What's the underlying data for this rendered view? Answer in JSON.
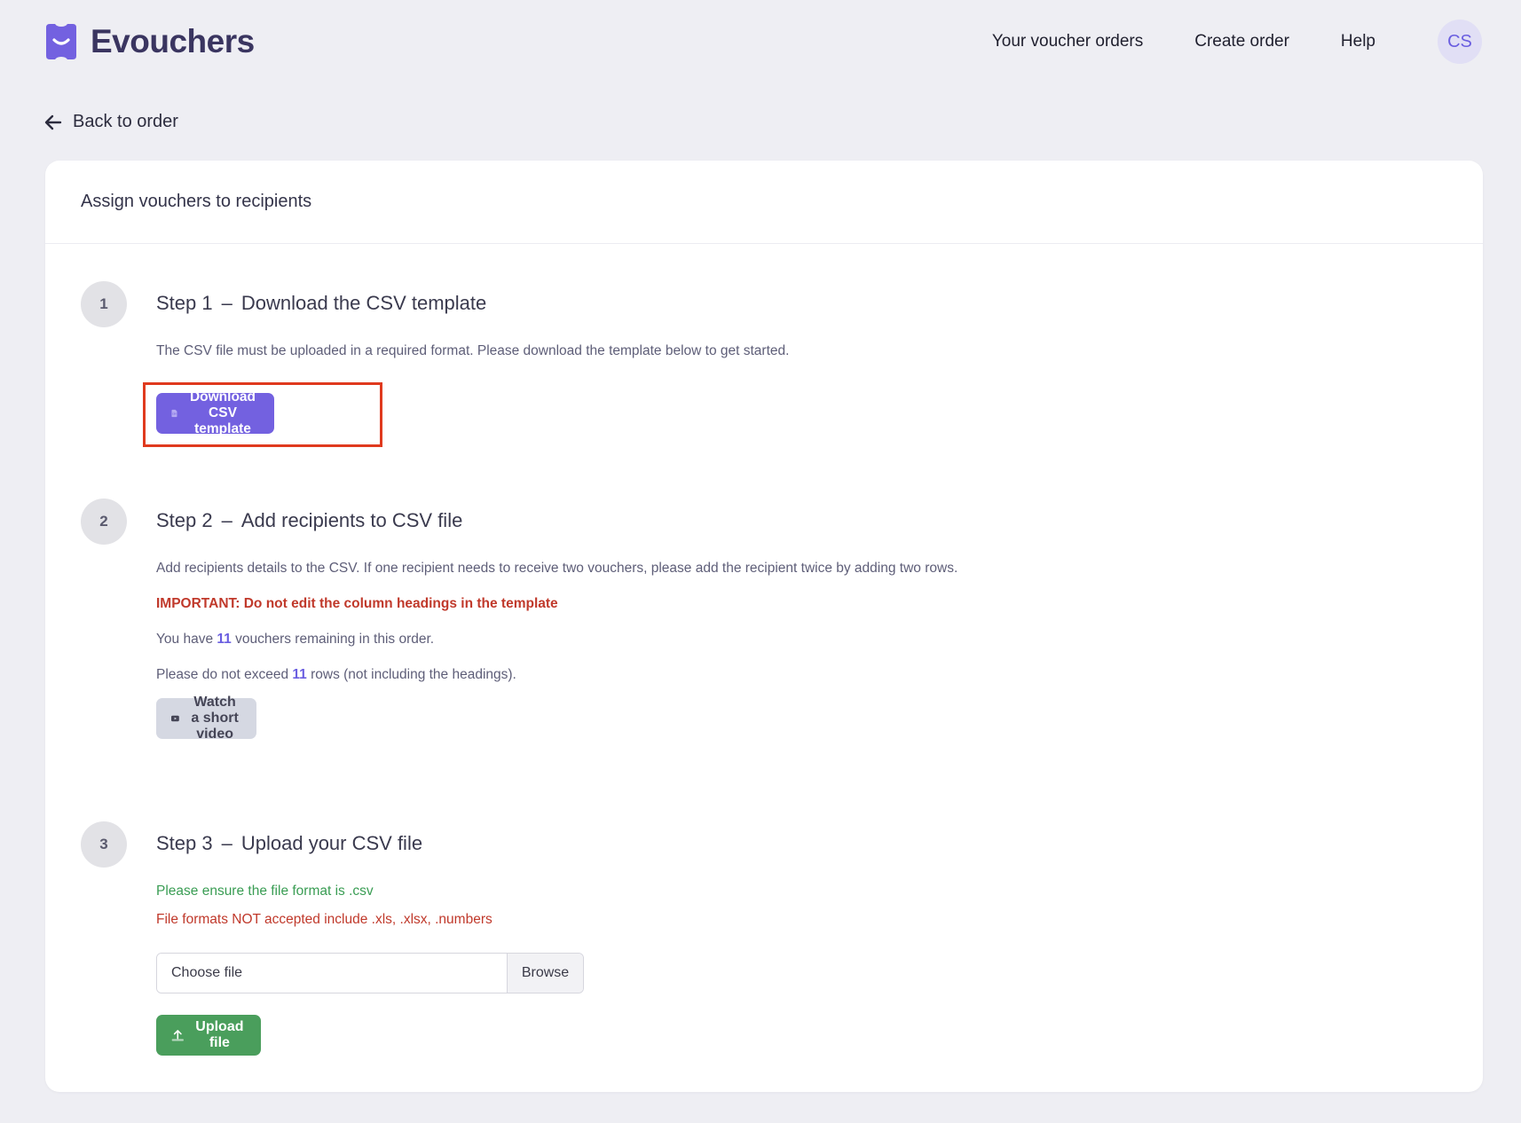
{
  "app": {
    "name": "Evouchers",
    "accent": "#7361e0"
  },
  "nav": {
    "orders": "Your voucher orders",
    "create": "Create order",
    "help": "Help",
    "avatar_initials": "CS"
  },
  "back": {
    "label": "Back to order",
    "icon": "arrow-left-icon"
  },
  "card": {
    "title": "Assign vouchers to recipients",
    "step1": {
      "number": "1",
      "label": "Step 1",
      "dash": "–",
      "title": "Download the CSV template",
      "description": "The CSV file must be uploaded in a required format. Please download the template below to get started.",
      "button": "Download CSV template",
      "button_icon": "csv-file-icon"
    },
    "step2": {
      "number": "2",
      "label": "Step 2",
      "dash": "–",
      "title": "Add recipients to CSV file",
      "description": "Add recipients details to the CSV. If one recipient needs to receive two vouchers, please add the recipient twice by adding two rows.",
      "important": "IMPORTANT: Do not edit the column headings in the template",
      "remaining_prefix": "You have ",
      "remaining_count": "11",
      "remaining_suffix": " vouchers remaining in this order.",
      "exceed_prefix": "Please do not exceed ",
      "exceed_count": "11",
      "exceed_suffix": " rows (not including the headings).",
      "video_button": "Watch a short video",
      "video_icon": "youtube-icon"
    },
    "step3": {
      "number": "3",
      "label": "Step 3",
      "dash": "–",
      "title": "Upload your CSV file",
      "format_ok": "Please ensure the file format is .csv",
      "format_not_ok": "File formats NOT accepted include .xls, .xlsx, .numbers",
      "file_placeholder": "Choose file",
      "browse": "Browse",
      "upload_button": "Upload file",
      "upload_icon": "upload-icon"
    }
  }
}
